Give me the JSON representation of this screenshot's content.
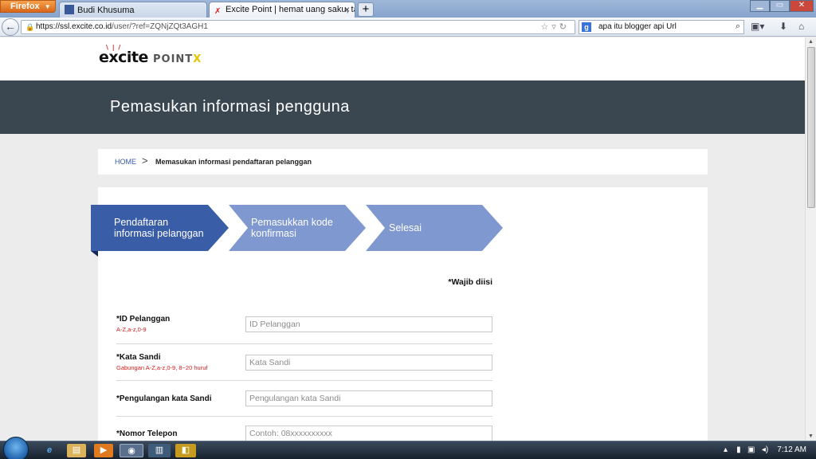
{
  "browser": {
    "menu_label": "Firefox",
    "tabs": [
      {
        "label": "Budi Khusuma",
        "icon": "facebook-icon"
      },
      {
        "label": "Excite Point | hemat uang saku, tamb...",
        "icon": "excite-icon"
      }
    ],
    "new_tab_label": "+",
    "url_host": "https://ssl.excite.co.id",
    "url_path": "/user/?ref=ZQNjZQt3AGH1",
    "search_text": "apa itu blogger api Url",
    "search_engine_letter": "g"
  },
  "site": {
    "logo_text": "excite",
    "logo_point": "POINT",
    "logo_x": "X",
    "page_title": "Pemasukan informasi pengguna"
  },
  "breadcrumb": {
    "home": "HOME",
    "separator": ">",
    "current": "Memasukan informasi pendaftaran pelanggan"
  },
  "steps": [
    {
      "line1": "Pendaftaran",
      "line2": "informasi pelanggan",
      "state": "active"
    },
    {
      "line1": "Pemasukkan kode",
      "line2": "konfirmasi",
      "state": "pending"
    },
    {
      "line1": "Selesai",
      "line2": "",
      "state": "pending"
    }
  ],
  "form": {
    "required_note": "*Wajib diisi",
    "fields": [
      {
        "label": "*ID Pelanggan",
        "hint": "A-Z,a-z,0-9",
        "placeholder": "ID Pelanggan"
      },
      {
        "label": "*Kata Sandi",
        "hint": "Gabungan A-Z,a-z,0-9, 8~20 huruf",
        "placeholder": "Kata Sandi"
      },
      {
        "label": "*Pengulangan kata Sandi",
        "hint": "",
        "placeholder": "Pengulangan kata Sandi"
      },
      {
        "label": "*Nomor Telepon",
        "hint": "",
        "placeholder": "Contoh: 08xxxxxxxxxx"
      }
    ]
  },
  "taskbar": {
    "clock": "7:12 AM"
  },
  "colors": {
    "title_bar": "#3a4650",
    "step_active": "#3a5da8",
    "step_pending": "#7f98d0",
    "hint_red": "#d21c1c",
    "breadcrumb_link": "#3559a8"
  }
}
